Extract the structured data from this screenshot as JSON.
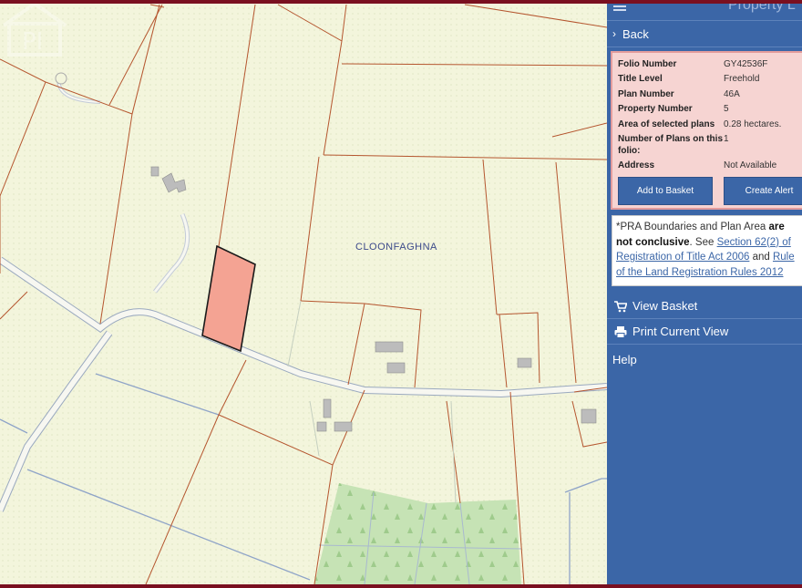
{
  "map": {
    "townland_label": "CLOONFAGHNA",
    "selected_parcel_color": "#f4a393",
    "boundary_color": "#b5562f",
    "forest_color": "#c6e3b5",
    "road_color": "#aebdd2",
    "watermark": "PI"
  },
  "panel": {
    "title": "Property L",
    "back_label": "Back",
    "fields": [
      {
        "key": "Folio Number",
        "value": "GY42536F"
      },
      {
        "key": "Title Level",
        "value": "Freehold"
      },
      {
        "key": "Plan Number",
        "value": "46A"
      },
      {
        "key": "Property Number",
        "value": "5"
      },
      {
        "key": "Area of selected plans",
        "value": "0.28 hectares."
      },
      {
        "key": "Number of Plans on this folio:",
        "value": "1"
      },
      {
        "key": "Address",
        "value": "Not Available"
      }
    ],
    "add_to_basket_label": "Add to Basket",
    "create_alert_label": "Create Alert",
    "notice": {
      "prefix": "*PRA Boundaries and Plan Area ",
      "bold": "are not conclusive",
      "middle": ". See ",
      "link1": "Section 62(2) of Registration of Title Act 2006",
      "and": " and ",
      "link2": "Rule of the Land Registration Rules 2012"
    },
    "view_basket_label": "View Basket",
    "print_label": "Print Current View",
    "help_label": "Help"
  },
  "colors": {
    "panel_bg": "#3b66a7",
    "card_bg": "#f6d4d2",
    "frame": "#7a1020"
  }
}
